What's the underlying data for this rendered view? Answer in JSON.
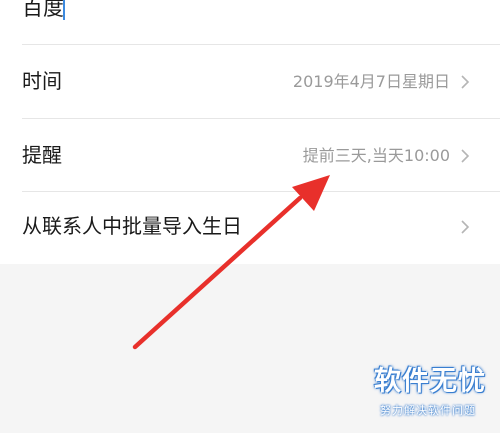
{
  "form": {
    "name_value": "百度",
    "rows": [
      {
        "label": "时间",
        "value": "2019年4月7日星期日"
      },
      {
        "label": "提醒",
        "value": "提前三天,当天10:00"
      },
      {
        "label": "从联系人中批量导入生日",
        "value": ""
      }
    ]
  },
  "icons": {
    "row_chevron": "chevron-right-icon"
  },
  "watermark": {
    "title": "软件无忧",
    "subtitle": "努力解决软件问题"
  },
  "colors": {
    "annotation_arrow": "#e8302b",
    "caret": "#3d8be0",
    "watermark": "#3a7fd0"
  }
}
